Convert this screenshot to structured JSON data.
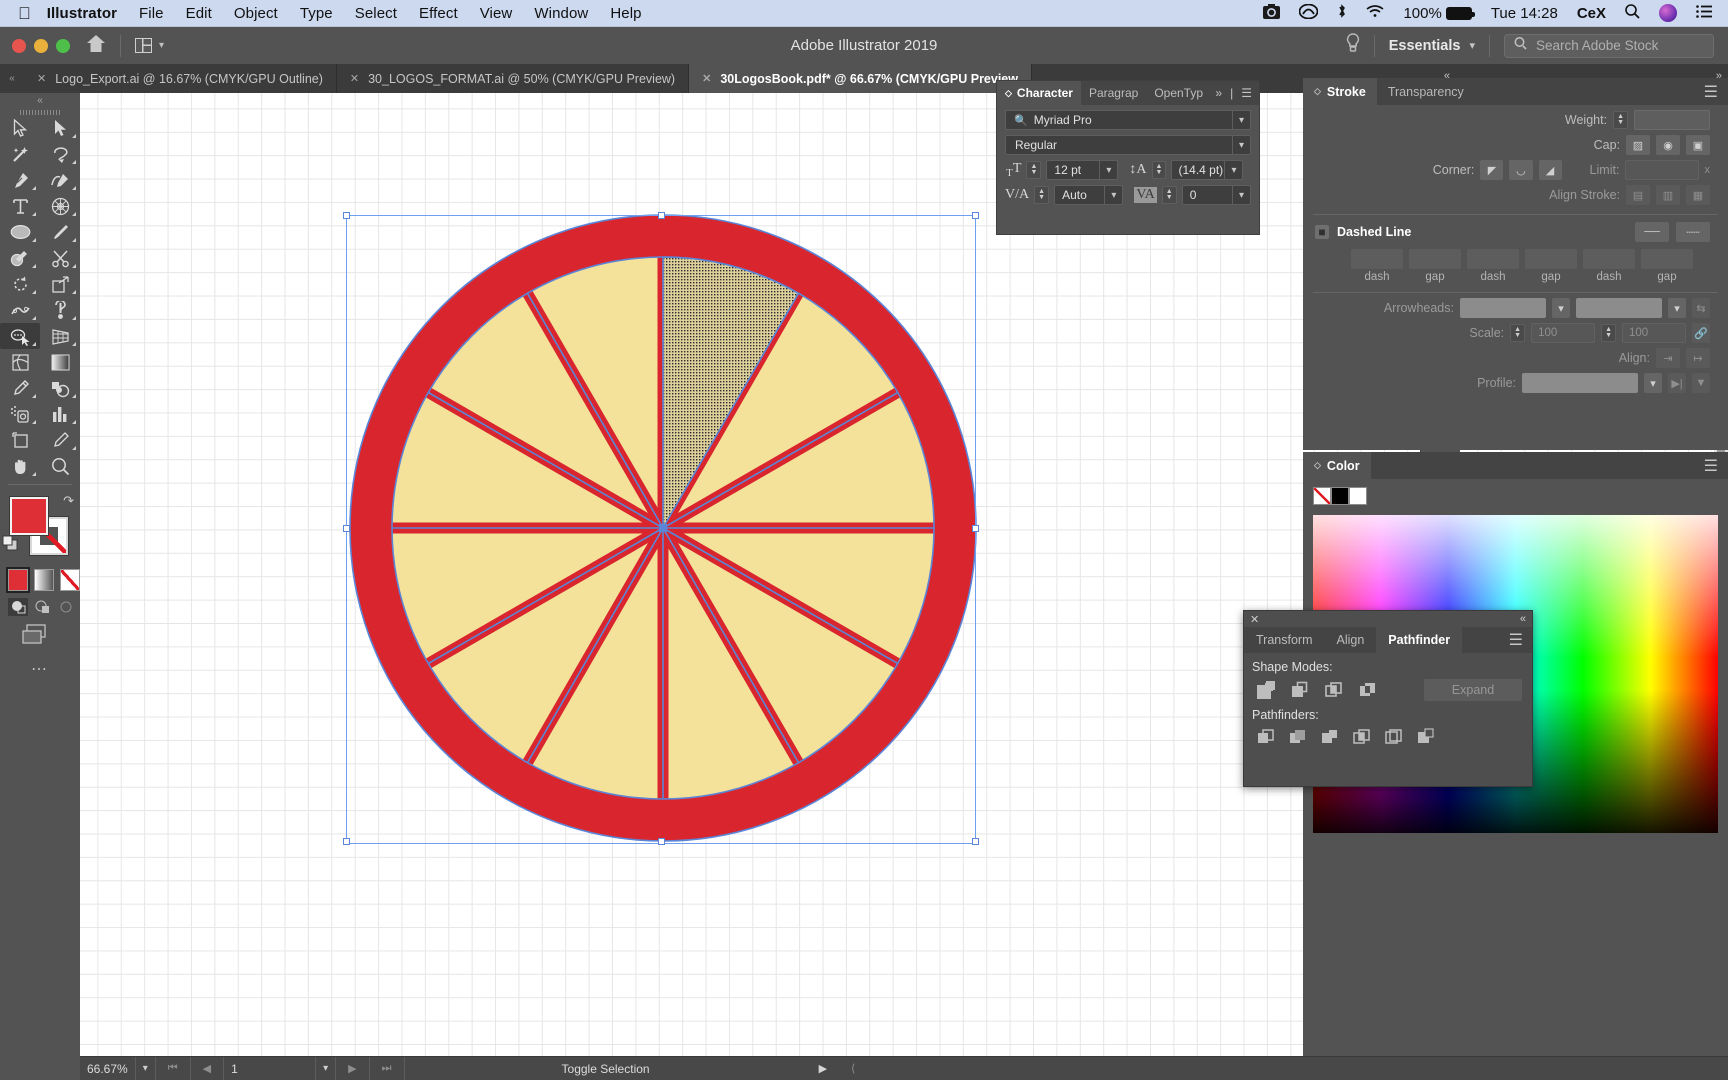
{
  "macbar": {
    "apple": "apple-logo",
    "items": [
      "Illustrator",
      "File",
      "Edit",
      "Object",
      "Type",
      "Select",
      "Effect",
      "View",
      "Window",
      "Help"
    ],
    "battery": "100%",
    "time": "Tue 14:28",
    "user": "CeX"
  },
  "titlebar": {
    "app_title": "Adobe Illustrator 2019",
    "workspace": "Essentials",
    "search_placeholder": "Search Adobe Stock"
  },
  "tabs": [
    {
      "label": "Logo_Export.ai @ 16.67% (CMYK/GPU Outline)",
      "active": false
    },
    {
      "label": "30_LOGOS_FORMAT.ai @ 50% (CMYK/GPU Preview)",
      "active": false
    },
    {
      "label": "30LogosBook.pdf* @ 66.67% (CMYK/GPU Preview",
      "active": true
    }
  ],
  "toolbar": {
    "tools": [
      "selection-tool",
      "direct-selection-tool",
      "magic-wand-tool",
      "lasso-tool",
      "pen-tool",
      "curvature-tool",
      "type-tool",
      "line-segment-tool",
      "ellipse-tool",
      "paintbrush-tool",
      "shaper-tool",
      "scissors-tool",
      "rotate-tool",
      "scale-tool",
      "width-tool",
      "free-transform-tool",
      "shape-builder-tool",
      "perspective-grid-tool",
      "mesh-tool",
      "gradient-tool",
      "eyedropper-tool",
      "blend-tool",
      "symbol-sprayer-tool",
      "column-graph-tool",
      "artboard-tool",
      "slice-tool",
      "hand-tool",
      "zoom-tool"
    ],
    "fill_color": "#dd2f35",
    "stroke_color": "none",
    "more_tools": "edit-toolbar"
  },
  "character_panel": {
    "tabs": [
      "Character",
      "Paragrap",
      "OpenTyp"
    ],
    "active_tab": "Character",
    "font_family": "Myriad Pro",
    "font_style": "Regular",
    "font_size": "12 pt",
    "leading": "(14.4 pt)",
    "kerning": "Auto",
    "tracking": "0"
  },
  "icon_strip": [
    "character-panel-icon",
    "paragraph-panel-icon",
    "glyphs-panel-icon"
  ],
  "stroke_panel": {
    "tabs": [
      "Stroke",
      "Transparency"
    ],
    "active_tab": "Stroke",
    "weight_label": "Weight:",
    "weight_value": "",
    "cap_label": "Cap:",
    "corner_label": "Corner:",
    "limit_label": "Limit:",
    "limit_value": "",
    "align_stroke_label": "Align Stroke:",
    "dashed_line_label": "Dashed Line",
    "dash_labels": [
      "dash",
      "gap",
      "dash",
      "gap",
      "dash",
      "gap"
    ],
    "arrowheads_label": "Arrowheads:",
    "scale_label": "Scale:",
    "scale_value_1": "100",
    "scale_value_2": "100",
    "align_label": "Align:",
    "profile_label": "Profile:"
  },
  "color_panel": {
    "title": "Color",
    "swatches": [
      "none-swatch",
      "black-swatch",
      "white-swatch"
    ]
  },
  "pathfinder_panel": {
    "tabs": [
      "Transform",
      "Align",
      "Pathfinder"
    ],
    "active_tab": "Pathfinder",
    "shape_modes_label": "Shape Modes:",
    "shape_modes": [
      "unite",
      "minus-front",
      "intersect",
      "exclude"
    ],
    "expand_label": "Expand",
    "pathfinders_label": "Pathfinders:",
    "pathfinders": [
      "divide",
      "trim",
      "merge",
      "crop",
      "outline",
      "minus-back"
    ]
  },
  "statusbar": {
    "zoom": "66.67%",
    "artboard_number": "1",
    "status_text": "Toggle Selection"
  },
  "artwork": {
    "name": "sliced-citrus-logo",
    "rind_color": "#d9252d",
    "flesh_color": "#f5e29a",
    "segments": 12,
    "selected_segment_index": 0
  }
}
